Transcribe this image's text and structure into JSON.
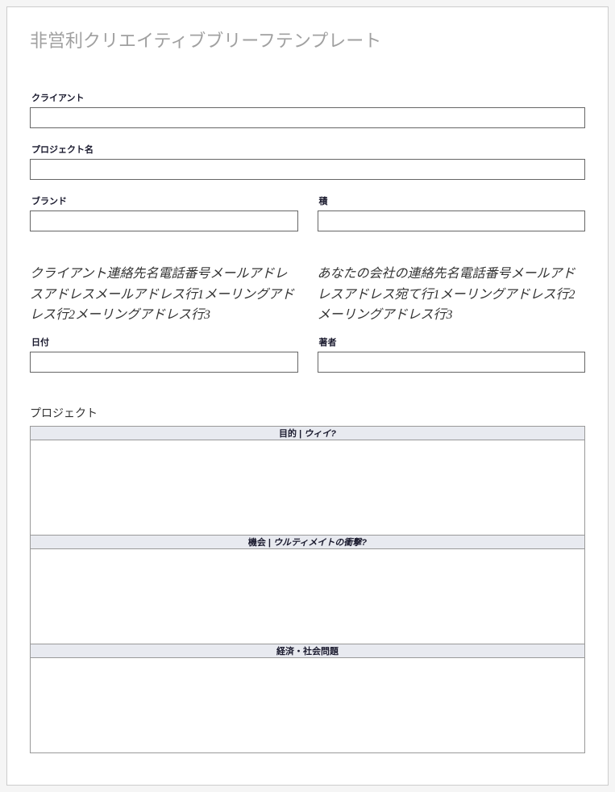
{
  "title": "非営利クリエイティブブリーフテンプレート",
  "fields": {
    "client": {
      "label": "クライアント",
      "value": ""
    },
    "projectName": {
      "label": "プロジェクト名",
      "value": ""
    },
    "brand": {
      "label": "ブランド",
      "value": ""
    },
    "product": {
      "label": "積",
      "value": ""
    },
    "date": {
      "label": "日付",
      "value": ""
    },
    "author": {
      "label": "著者",
      "value": ""
    }
  },
  "contacts": {
    "client": "クライアント連絡先名電話番号メールアドレスアドレスメールアドレス行1メーリングアドレス行2メーリングアドレス行3",
    "company": "あなたの会社の連絡先名電話番号メールアドレスアドレス宛て行1メーリングアドレス行2メーリングアドレス行3"
  },
  "project": {
    "sectionLabel": "プロジェクト",
    "rows": [
      {
        "header_plain": "目的 | ",
        "header_italic": "ウィイ?"
      },
      {
        "header_plain": "機会 | ",
        "header_italic": "ウルティメイトの衝撃?"
      },
      {
        "header_plain": "経済・社会問題",
        "header_italic": ""
      }
    ]
  }
}
